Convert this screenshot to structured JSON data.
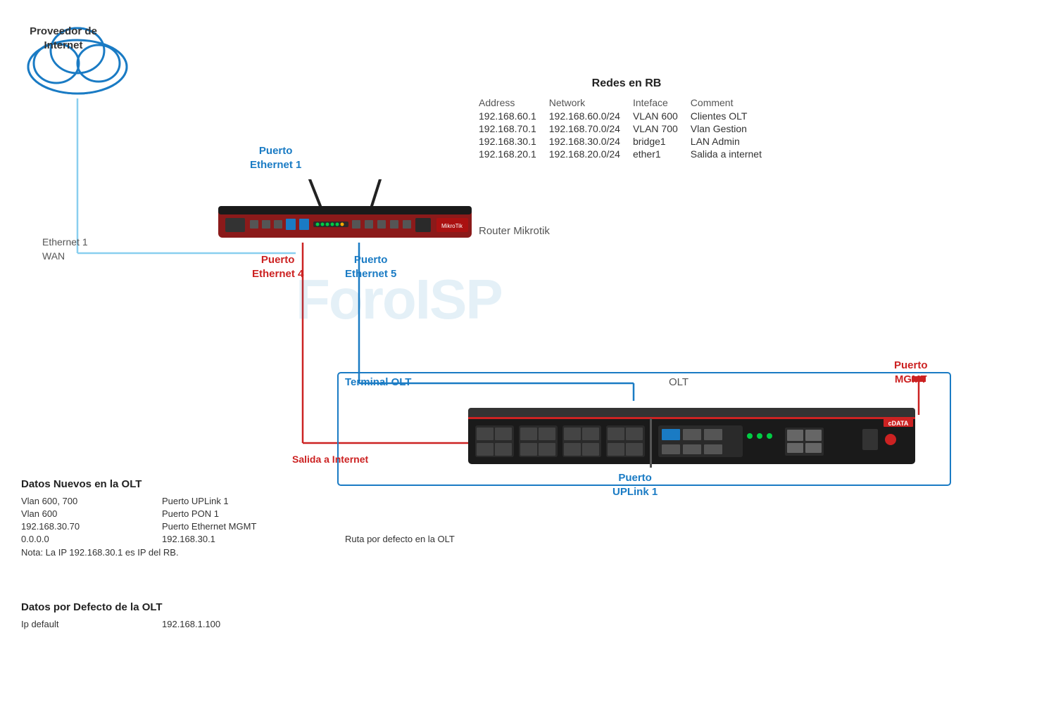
{
  "cloud": {
    "label_line1": "Proveedor de",
    "label_line2": "Internet"
  },
  "eth1_wan": {
    "line1": "Ethernet 1",
    "line2": "WAN"
  },
  "router_label": "Router Mikrotik",
  "olt_label": "OLT",
  "terminal_olt_label": "Terminal OLT",
  "salida_internet_label": "Salida a Internet",
  "ports": {
    "eth1": {
      "line1": "Puerto",
      "line2": "Ethernet 1"
    },
    "eth4": {
      "line1": "Puerto",
      "line2": "Ethernet 4"
    },
    "eth5": {
      "line1": "Puerto",
      "line2": "Ethernet 5"
    },
    "mgmt": {
      "line1": "Puerto",
      "line2": "MGMT"
    },
    "uplink1": {
      "line1": "Puerto",
      "line2": "UPLink 1"
    }
  },
  "redes_rb": {
    "title": "Redes en RB",
    "headers": [
      "Address",
      "Network",
      "Inteface",
      "Comment"
    ],
    "rows": [
      [
        "192.168.60.1",
        "192.168.60.0/24",
        "VLAN 600",
        "Clientes OLT"
      ],
      [
        "192.168.70.1",
        "192.168.70.0/24",
        "VLAN 700",
        "Vlan Gestion"
      ],
      [
        "192.168.30.1",
        "192.168.30.0/24",
        "bridge1",
        "LAN Admin"
      ],
      [
        "192.168.20.1",
        "192.168.20.0/24",
        "ether1",
        "Salida a internet"
      ]
    ]
  },
  "datos_nuevos": {
    "title": "Datos Nuevos en  la OLT",
    "rows": [
      {
        "col1": "Vlan 600, 700",
        "col2": "Puerto UPLink 1",
        "col3": ""
      },
      {
        "col1": "Vlan 600",
        "col2": "Puerto PON 1",
        "col3": ""
      },
      {
        "col1": "192.168.30.70",
        "col2": "Puerto Ethernet MGMT",
        "col3": ""
      },
      {
        "col1": "0.0.0.0",
        "col2": "192.168.30.1",
        "col3": "Ruta  por defecto en la OLT"
      }
    ],
    "nota": "Nota: La IP 192.168.30.1 es IP del RB."
  },
  "datos_defecto": {
    "title": "Datos por Defecto de la OLT",
    "rows": [
      {
        "col1": "Ip default",
        "col2": "192.168.1.100"
      }
    ]
  },
  "watermark": "ForoISP"
}
